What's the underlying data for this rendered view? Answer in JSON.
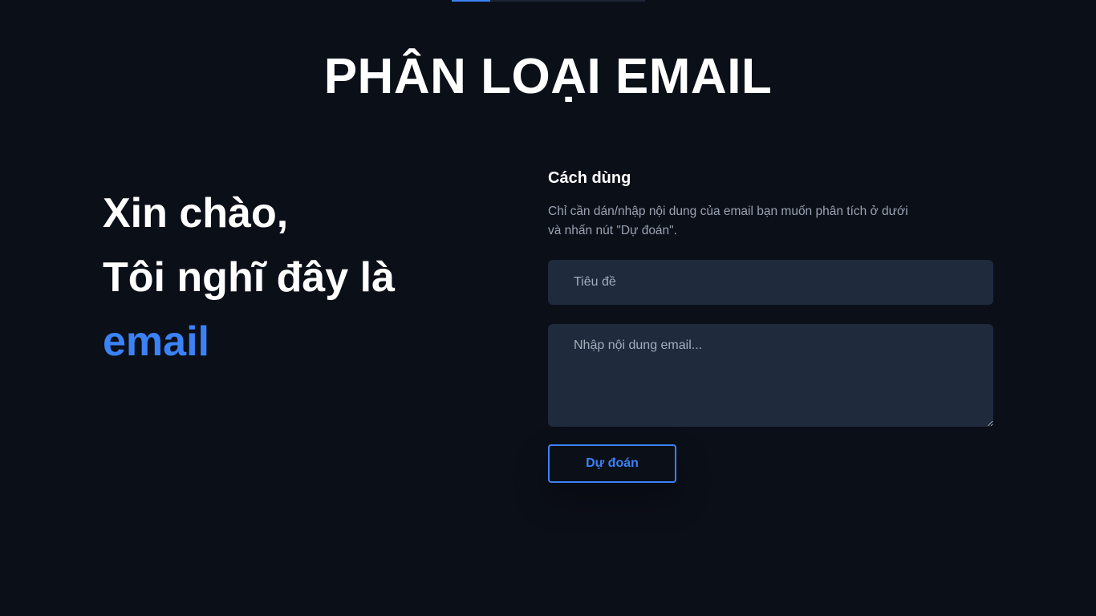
{
  "header": {
    "title": "PHÂN LOẠI EMAIL"
  },
  "hero": {
    "line1": "Xin chào,",
    "line2": "Tôi nghĩ đây là",
    "line3": "email"
  },
  "usage": {
    "heading": "Cách dùng",
    "description": "Chỉ cần dán/nhập nội dung của email bạn muốn phân tích ở dưới và nhấn nút \"Dự đoán\"."
  },
  "form": {
    "subject_placeholder": "Tiêu đề",
    "subject_value": "",
    "body_placeholder": "Nhập nội dung email...",
    "body_value": "",
    "predict_label": "Dự đoán"
  },
  "colors": {
    "background": "#0b0f18",
    "accent": "#3b82f6",
    "field": "#1f2a3d",
    "muted_text": "#9aa3b2"
  }
}
